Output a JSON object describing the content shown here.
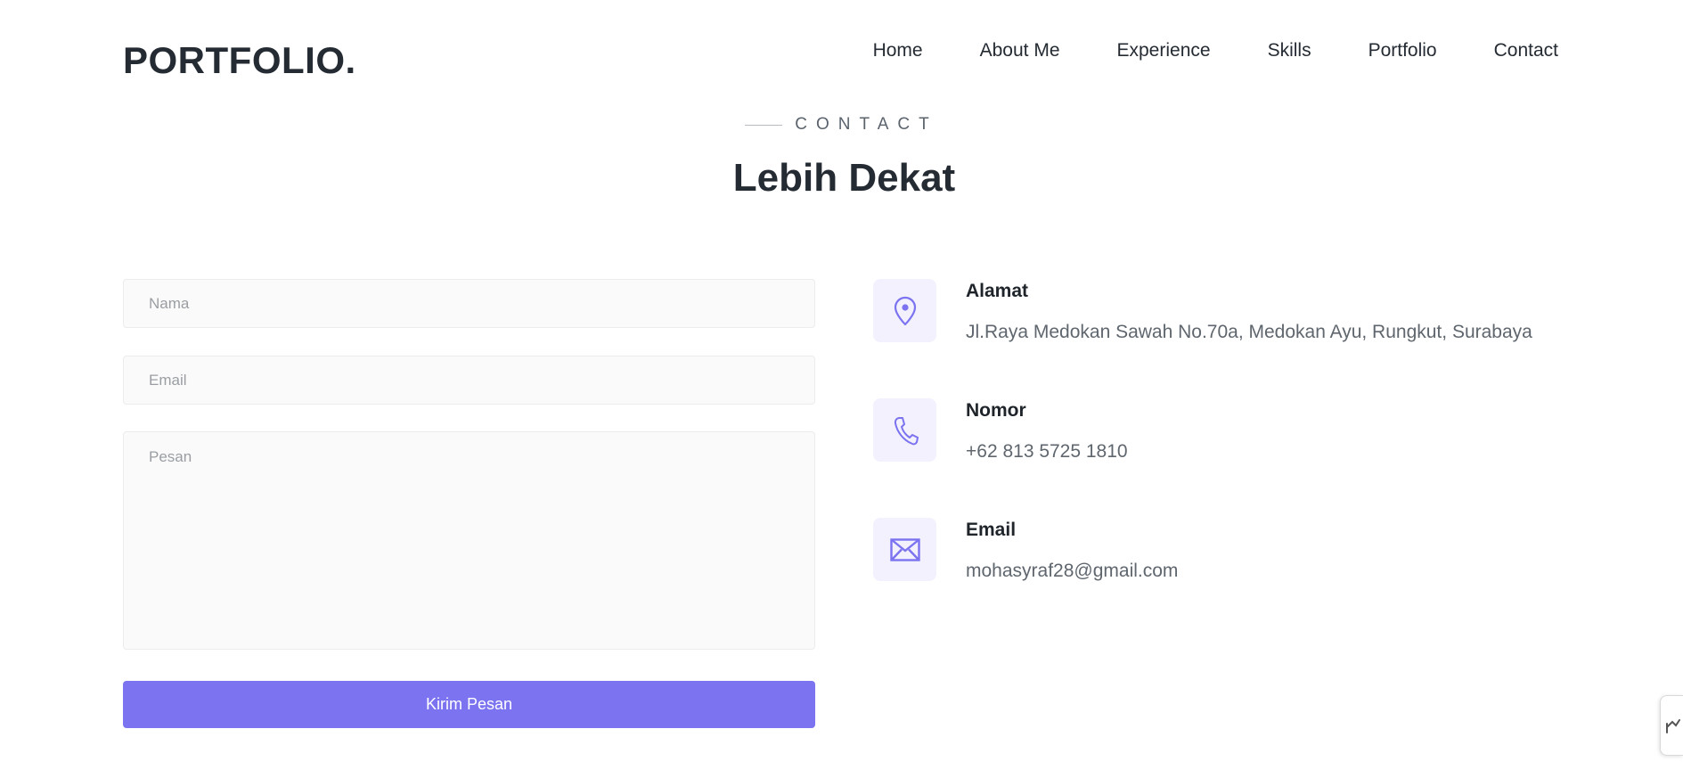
{
  "brand": {
    "logo": "PORTFOLIO."
  },
  "nav": {
    "items": [
      {
        "label": "Home"
      },
      {
        "label": "About Me"
      },
      {
        "label": "Experience"
      },
      {
        "label": "Skills"
      },
      {
        "label": "Portfolio"
      },
      {
        "label": "Contact"
      }
    ]
  },
  "section": {
    "eyebrow": "CONTACT",
    "title": "Lebih Dekat"
  },
  "form": {
    "name_placeholder": "Nama",
    "email_placeholder": "Email",
    "message_placeholder": "Pesan",
    "submit_label": "Kirim Pesan"
  },
  "contact": {
    "address": {
      "title": "Alamat",
      "value": "Jl.Raya Medokan Sawah No.70a, Medokan Ayu, Rungkut, Surabaya",
      "icon": "map-pin-icon"
    },
    "phone": {
      "title": "Nomor",
      "value": "+62 813 5725 1810",
      "icon": "phone-icon"
    },
    "email": {
      "title": "Email",
      "value": "mohasyraf28@gmail.com",
      "icon": "envelope-icon"
    }
  },
  "colors": {
    "accent": "#7b73ef",
    "icon_bg": "#f3f1fe",
    "text_dark": "#252b33",
    "text_muted": "#5f666e"
  }
}
